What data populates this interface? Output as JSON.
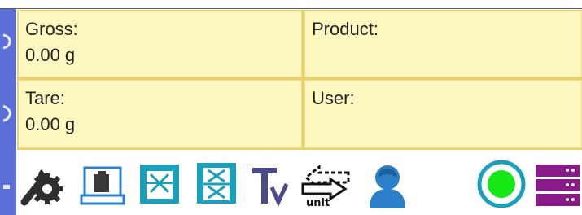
{
  "panel": {
    "gross": {
      "label": "Gross:",
      "value": "0.00 g"
    },
    "product": {
      "label": "Product:",
      "value": ""
    },
    "tare": {
      "label": "Tare:",
      "value": "0.00 g"
    },
    "user": {
      "label": "User:",
      "value": ""
    }
  },
  "toolbar": {
    "unit_text": "unit",
    "buttons": [
      {
        "icon": "settings-wrench-gear-icon"
      },
      {
        "icon": "tare-weight-scale-icon"
      },
      {
        "icon": "clear-x-panel-icon"
      },
      {
        "icon": "clear-x-split-panel-icon"
      },
      {
        "icon": "text-check-icon"
      },
      {
        "icon": "unit-switch-arrows-icon"
      },
      {
        "icon": "user-profile-icon"
      },
      {
        "icon": "status-indicator-green-icon"
      },
      {
        "icon": "database-server-icon"
      }
    ]
  },
  "colors": {
    "sidebar": "#5a6fd8",
    "cell_bg": "#fdf8c0",
    "cell_border": "#e9d06c",
    "icon_blue": "#2a7fc8",
    "icon_teal": "#1aa0b8",
    "status_green": "#17e617",
    "server_purple": "#8a1a8a"
  }
}
